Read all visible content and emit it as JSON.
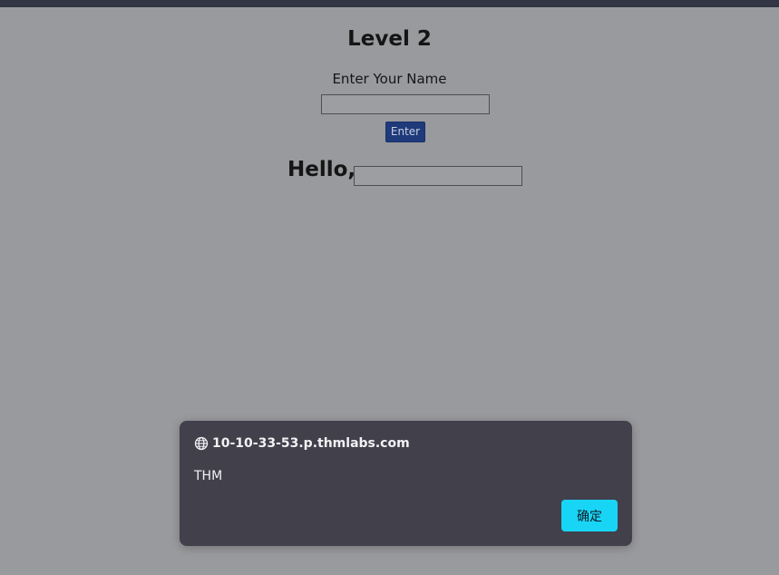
{
  "page": {
    "title": "Level 2",
    "name_label": "Enter Your Name",
    "name_input_value": "",
    "enter_button": "Enter",
    "hello_text": "Hello,",
    "hello_input_value": ""
  },
  "dialog": {
    "origin": "10-10-33-53.p.thmlabs.com",
    "origin_icon": "globe-icon",
    "message": "THM",
    "ok_button": "确定"
  },
  "colors": {
    "background": "#999a9d",
    "topbar": "#323543",
    "enter_button": "#1f3a7a",
    "dialog_bg": "#41404b",
    "ok_button": "#19d5f5"
  }
}
